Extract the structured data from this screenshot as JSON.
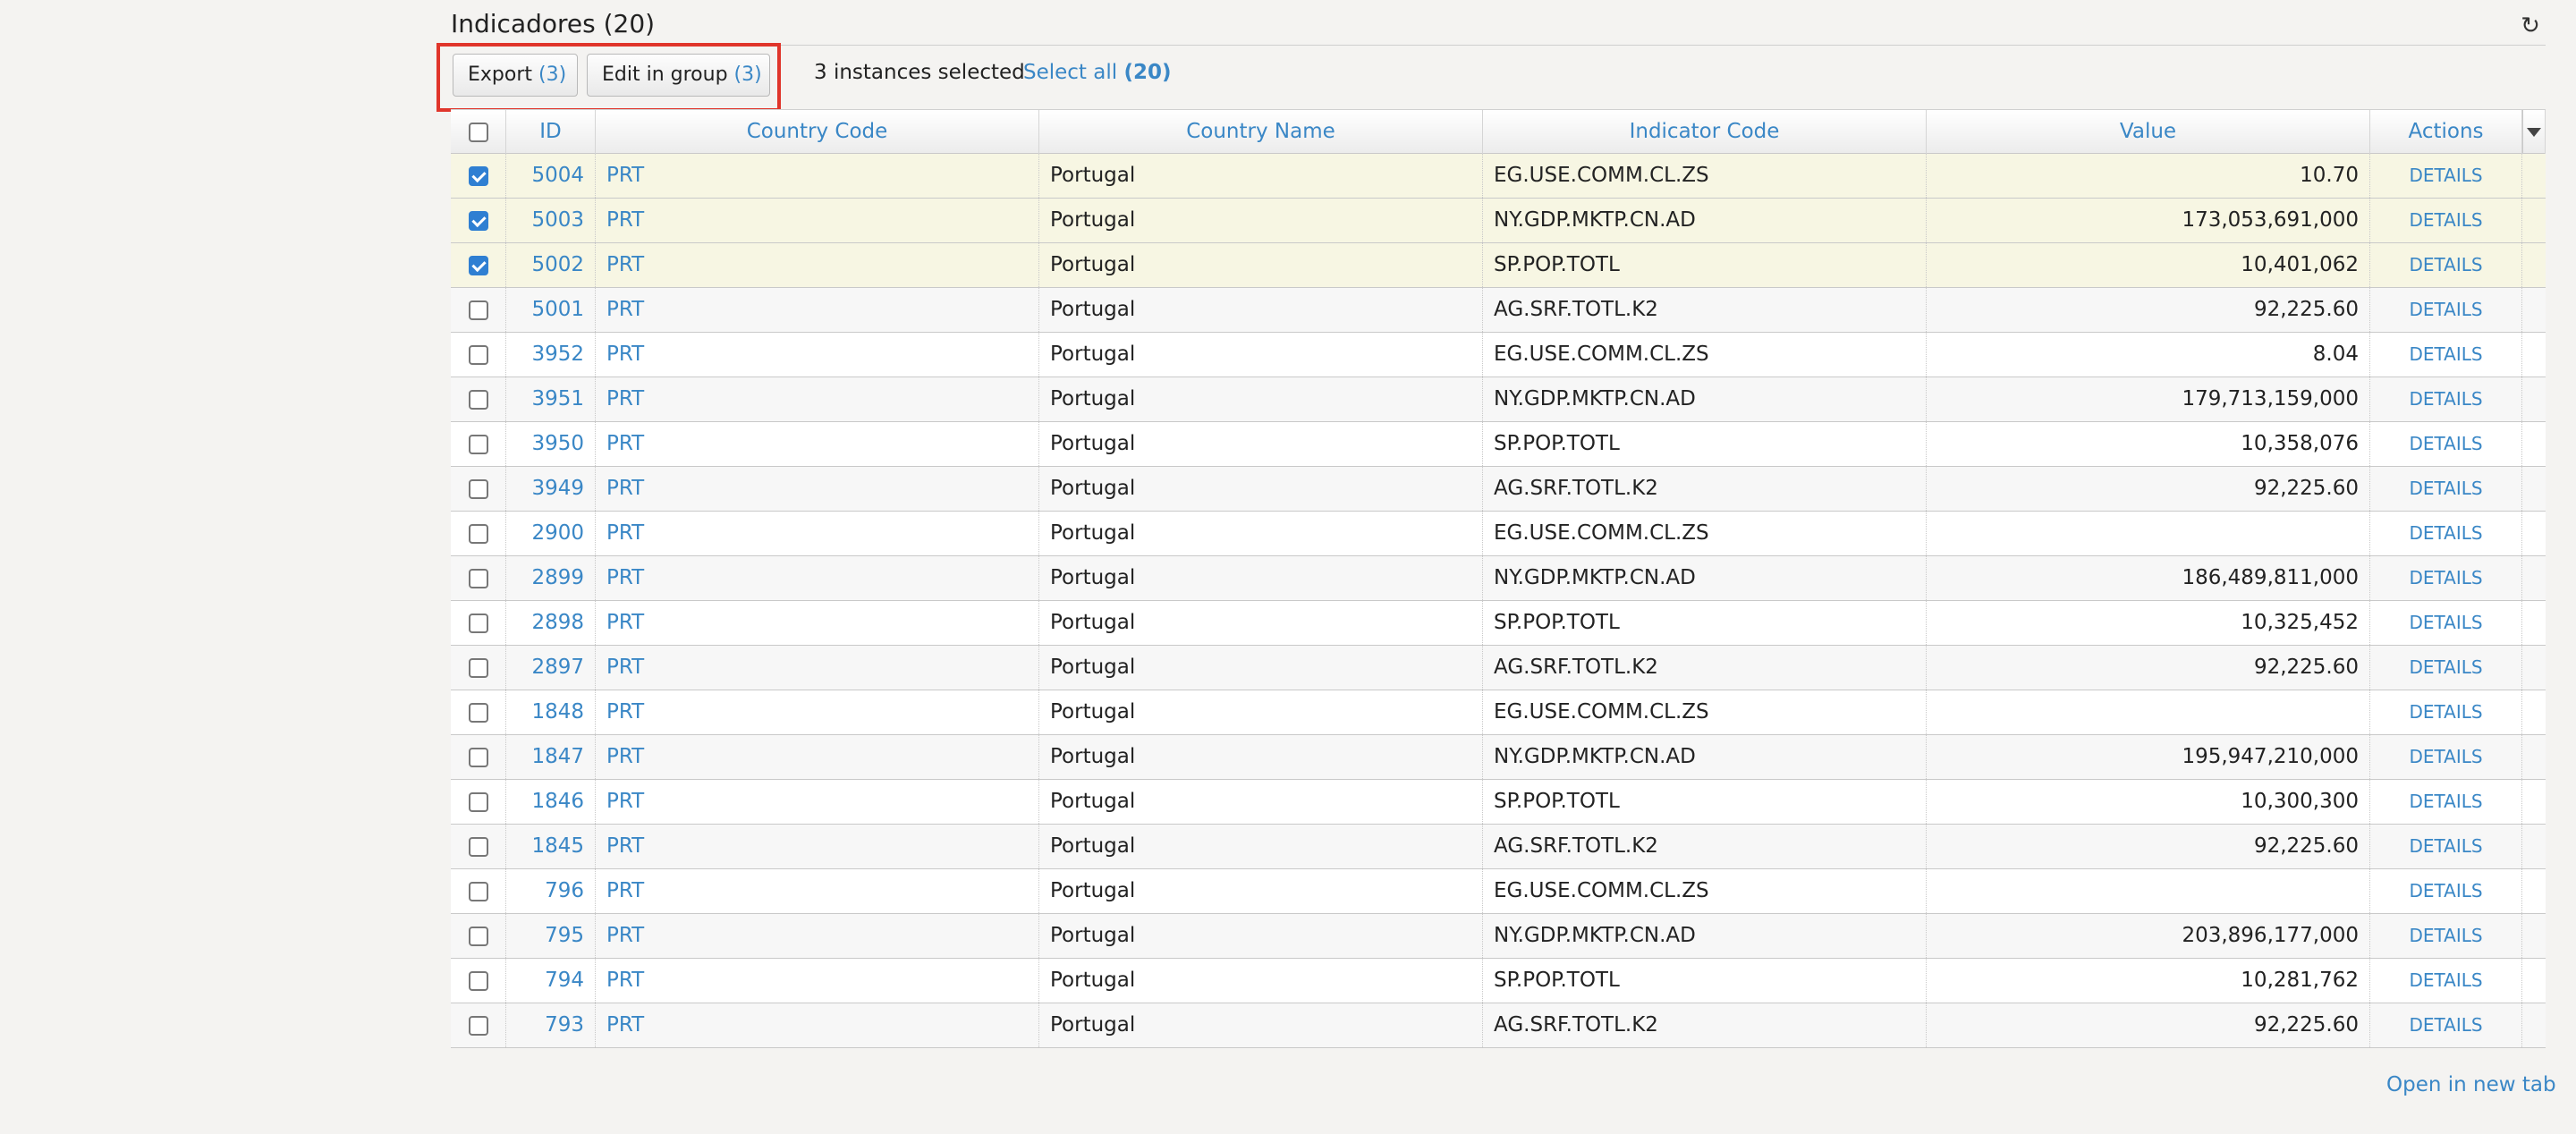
{
  "panel": {
    "title": "Indicadores (20)",
    "refresh_icon": "refresh-icon"
  },
  "toolbar": {
    "export_label": "Export",
    "export_count": "(3)",
    "edit_label": "Edit in group",
    "edit_count": "(3)",
    "selection_text": "3 instances selected",
    "select_all_label": "Select all",
    "select_all_count": "(20)"
  },
  "table": {
    "columns": [
      "ID",
      "Country Code",
      "Country Name",
      "Indicator Code",
      "Value",
      "Actions"
    ],
    "rows": [
      {
        "id": "5004",
        "cc": "PRT",
        "cn": "Portugal",
        "ic": "EG.USE.COMM.CL.ZS",
        "value": "10.70",
        "action": "DETAILS",
        "selected": true
      },
      {
        "id": "5003",
        "cc": "PRT",
        "cn": "Portugal",
        "ic": "NY.GDP.MKTP.CN.AD",
        "value": "173,053,691,000",
        "action": "DETAILS",
        "selected": true
      },
      {
        "id": "5002",
        "cc": "PRT",
        "cn": "Portugal",
        "ic": "SP.POP.TOTL",
        "value": "10,401,062",
        "action": "DETAILS",
        "selected": true
      },
      {
        "id": "5001",
        "cc": "PRT",
        "cn": "Portugal",
        "ic": "AG.SRF.TOTL.K2",
        "value": "92,225.60",
        "action": "DETAILS",
        "selected": false
      },
      {
        "id": "3952",
        "cc": "PRT",
        "cn": "Portugal",
        "ic": "EG.USE.COMM.CL.ZS",
        "value": "8.04",
        "action": "DETAILS",
        "selected": false
      },
      {
        "id": "3951",
        "cc": "PRT",
        "cn": "Portugal",
        "ic": "NY.GDP.MKTP.CN.AD",
        "value": "179,713,159,000",
        "action": "DETAILS",
        "selected": false
      },
      {
        "id": "3950",
        "cc": "PRT",
        "cn": "Portugal",
        "ic": "SP.POP.TOTL",
        "value": "10,358,076",
        "action": "DETAILS",
        "selected": false
      },
      {
        "id": "3949",
        "cc": "PRT",
        "cn": "Portugal",
        "ic": "AG.SRF.TOTL.K2",
        "value": "92,225.60",
        "action": "DETAILS",
        "selected": false
      },
      {
        "id": "2900",
        "cc": "PRT",
        "cn": "Portugal",
        "ic": "EG.USE.COMM.CL.ZS",
        "value": "",
        "action": "DETAILS",
        "selected": false
      },
      {
        "id": "2899",
        "cc": "PRT",
        "cn": "Portugal",
        "ic": "NY.GDP.MKTP.CN.AD",
        "value": "186,489,811,000",
        "action": "DETAILS",
        "selected": false
      },
      {
        "id": "2898",
        "cc": "PRT",
        "cn": "Portugal",
        "ic": "SP.POP.TOTL",
        "value": "10,325,452",
        "action": "DETAILS",
        "selected": false
      },
      {
        "id": "2897",
        "cc": "PRT",
        "cn": "Portugal",
        "ic": "AG.SRF.TOTL.K2",
        "value": "92,225.60",
        "action": "DETAILS",
        "selected": false
      },
      {
        "id": "1848",
        "cc": "PRT",
        "cn": "Portugal",
        "ic": "EG.USE.COMM.CL.ZS",
        "value": "",
        "action": "DETAILS",
        "selected": false
      },
      {
        "id": "1847",
        "cc": "PRT",
        "cn": "Portugal",
        "ic": "NY.GDP.MKTP.CN.AD",
        "value": "195,947,210,000",
        "action": "DETAILS",
        "selected": false
      },
      {
        "id": "1846",
        "cc": "PRT",
        "cn": "Portugal",
        "ic": "SP.POP.TOTL",
        "value": "10,300,300",
        "action": "DETAILS",
        "selected": false
      },
      {
        "id": "1845",
        "cc": "PRT",
        "cn": "Portugal",
        "ic": "AG.SRF.TOTL.K2",
        "value": "92,225.60",
        "action": "DETAILS",
        "selected": false
      },
      {
        "id": "796",
        "cc": "PRT",
        "cn": "Portugal",
        "ic": "EG.USE.COMM.CL.ZS",
        "value": "",
        "action": "DETAILS",
        "selected": false
      },
      {
        "id": "795",
        "cc": "PRT",
        "cn": "Portugal",
        "ic": "NY.GDP.MKTP.CN.AD",
        "value": "203,896,177,000",
        "action": "DETAILS",
        "selected": false
      },
      {
        "id": "794",
        "cc": "PRT",
        "cn": "Portugal",
        "ic": "SP.POP.TOTL",
        "value": "10,281,762",
        "action": "DETAILS",
        "selected": false
      },
      {
        "id": "793",
        "cc": "PRT",
        "cn": "Portugal",
        "ic": "AG.SRF.TOTL.K2",
        "value": "92,225.60",
        "action": "DETAILS",
        "selected": false
      }
    ]
  },
  "footer": {
    "open_new_tab": "Open in new tab"
  },
  "colors": {
    "link": "#3a87c6",
    "selected_row": "#f7f6e3",
    "highlight_border": "#e0352b",
    "checkbox_on": "#2f7fd2"
  }
}
